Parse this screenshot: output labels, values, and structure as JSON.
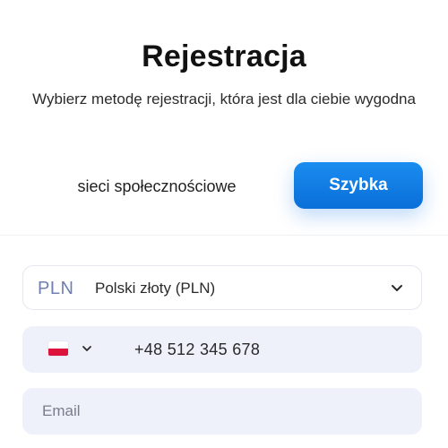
{
  "header": {
    "title": "Rejestracja",
    "subtitle": "Wybierz metodę rejestracji, która jest dla ciebie wygodna"
  },
  "tabs": [
    {
      "label": "sieci społecznościowe",
      "active": false
    },
    {
      "label": "Szybka",
      "active": true
    }
  ],
  "currency": {
    "code": "PLN",
    "name": "Polski złoty (PLN)",
    "icon": "chevron-down-icon"
  },
  "phone": {
    "country_flag": "poland-flag-icon",
    "value": "+48  512 345 678"
  },
  "email": {
    "placeholder": "Email",
    "value": ""
  },
  "colors": {
    "accent": "#0f7fe6",
    "field_bg": "#eef0fa",
    "currency_code": "#6f7fb0"
  }
}
